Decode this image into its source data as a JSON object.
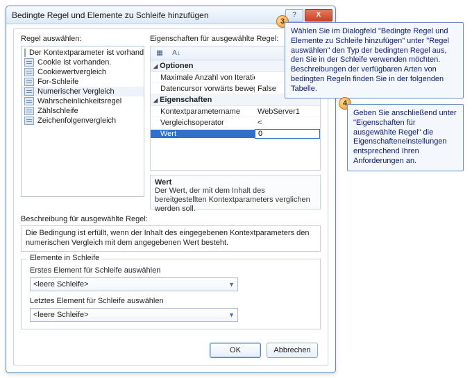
{
  "dialog": {
    "title": "Bedingte Regel und Elemente zu Schleife hinzufügen",
    "help_icon": "?",
    "close_icon": "X"
  },
  "left": {
    "label": "Regel auswählen:",
    "items": [
      "Der Kontextparameter ist vorhanden.",
      "Cookie ist vorhanden.",
      "Cookiewertvergleich",
      "For-Schleife",
      "Numerischer Vergleich",
      "Wahrscheinlichkeitsregel",
      "Zählschleife",
      "Zeichenfolgenvergleich"
    ],
    "selected_index": 4
  },
  "right": {
    "label": "Eigenschaften für ausgewählte Regel:",
    "toolbar": {
      "cat_icon": "▦",
      "sort_icon": "A↓"
    },
    "sections": {
      "optionen": "Optionen",
      "eigenschaften": "Eigenschaften"
    },
    "rows": {
      "max_iter": {
        "name": "Maximale Anzahl von Iterationen",
        "value": ""
      },
      "datencursor": {
        "name": "Datencursor vorwärts bewegen",
        "value": "False"
      },
      "kontextparam": {
        "name": "Kontextparametername",
        "value": "WebServer1"
      },
      "operator": {
        "name": "Vergleichsoperator",
        "value": "<"
      },
      "wert": {
        "name": "Wert",
        "value": "0"
      }
    },
    "desc": {
      "heading": "Wert",
      "text": "Der Wert, der mit dem Inhalt des bereitgestellten Kontextparameters verglichen werden soll."
    }
  },
  "rule_desc": {
    "label": "Beschreibung für ausgewählte Regel:",
    "text": "Die Bedingung ist erfüllt, wenn der Inhalt des eingegebenen Kontextparameters den numerischen Vergleich mit dem angegebenen Wert besteht."
  },
  "loop": {
    "legend": "Elemente in Schleife",
    "first_label": "Erstes Element für Schleife auswählen",
    "first_value": "<leere Schleife>",
    "last_label": "Letztes Element für Schleife auswählen",
    "last_value": "<leere Schleife>"
  },
  "buttons": {
    "ok": "OK",
    "cancel": "Abbrechen"
  },
  "callouts": {
    "c3": {
      "num": "3",
      "text": "Wählen Sie im Dialogfeld \"Bedingte Regel und Elemente zu Schleife hinzufügen\" unter \"Regel auswählen\" den Typ der bedingten Regel aus, den Sie in der Schleife verwenden möchten. Beschreibungen der verfügbaren Arten von bedingten Regeln finden Sie in der folgenden Tabelle."
    },
    "c4": {
      "num": "4",
      "text": "Geben Sie anschließend unter \"Eigenschaften für ausgewählte Regel\" die Eigenschafteneinstellungen entsprechend Ihren Anforderungen an."
    }
  }
}
